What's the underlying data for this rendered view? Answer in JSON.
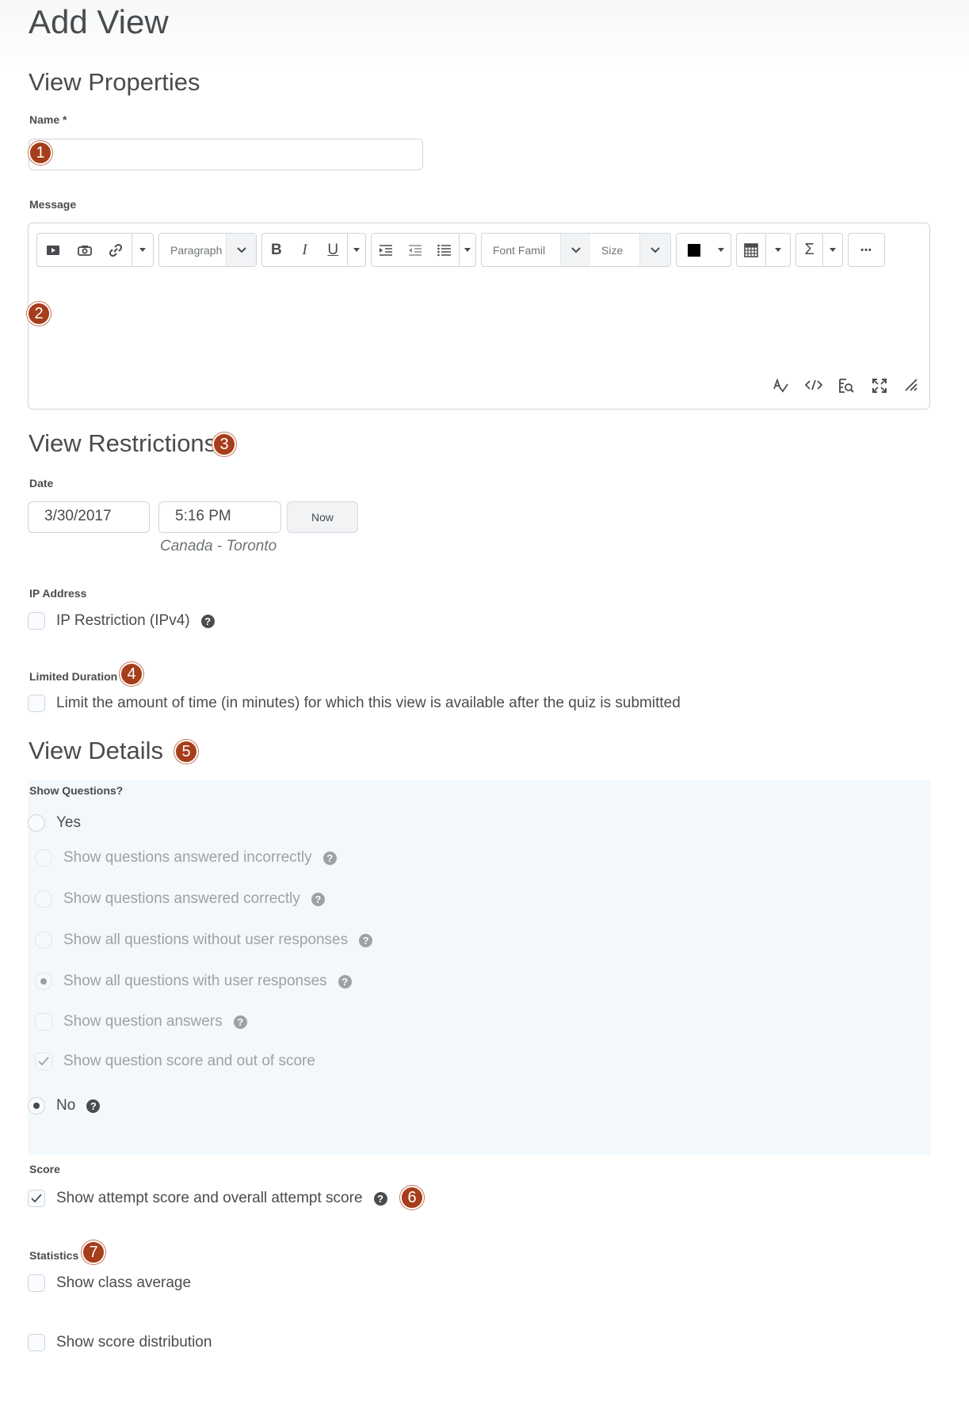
{
  "page": {
    "title": "Add View"
  },
  "properties": {
    "heading": "View Properties",
    "name_label": "Name *",
    "name_value": "",
    "message_label": "Message",
    "toolbar": {
      "paragraph": "Paragraph",
      "font_family": "Font Famil",
      "size": "Size",
      "bold": "B",
      "italic": "I",
      "underline": "U",
      "equation": "Σ",
      "more": "•••"
    },
    "editor_icons": [
      "insert-media-icon",
      "insert-stuff-icon",
      "link-icon",
      "indent-icon",
      "outdent-icon",
      "list-icon",
      "color-swatch-icon",
      "table-icon",
      "spellcheck-icon",
      "source-code-icon",
      "preview-icon",
      "fullscreen-icon",
      "resize-handle-icon"
    ]
  },
  "restrictions": {
    "heading": "View Restrictions",
    "date_label": "Date",
    "date_value": "3/30/2017",
    "time_value": "5:16 PM",
    "now_button": "Now",
    "timezone": "Canada - Toronto",
    "ip_label": "IP Address",
    "ip_option": "IP Restriction (IPv4)",
    "duration_label": "Limited Duration",
    "duration_option": "Limit the amount of time (in minutes) for which this view is available after the quiz is submitted"
  },
  "details": {
    "heading": "View Details",
    "show_questions_label": "Show Questions?",
    "yes": "Yes",
    "sub_options": [
      "Show questions answered incorrectly",
      "Show questions answered correctly",
      "Show all questions without user responses",
      "Show all questions with user responses",
      "Show question answers",
      "Show question score and out of score"
    ],
    "no": "No",
    "score_label": "Score",
    "score_option": "Show attempt score and overall attempt score",
    "statistics_label": "Statistics",
    "stat_options": [
      "Show class average",
      "Show score distribution"
    ]
  },
  "badges": [
    "1",
    "2",
    "3",
    "4",
    "5",
    "6",
    "7"
  ],
  "colors": {
    "badge": "#a63d1b",
    "panel": "#f2f8fc",
    "text": "#494c4e"
  }
}
